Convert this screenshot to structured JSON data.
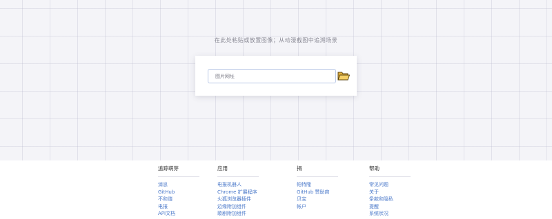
{
  "drop": {
    "hint": "在此处粘贴或放置图像；从动漫截图中追溯场景",
    "url_placeholder": "图片网址"
  },
  "footer": {
    "columns": [
      {
        "title": "追踪萌芽",
        "links": [
          "消息",
          "GitHub",
          "不和谐",
          "电报",
          "API文档"
        ]
      },
      {
        "title": "应用",
        "links": [
          "电报机器人",
          "Chrome 扩展程序",
          "火狐浏览器插件",
          "边缘附加组件",
          "歌剧附加组件"
        ]
      },
      {
        "title": "捐",
        "links": [
          "帕特隆",
          "GitHub 赞助商",
          "贝宝",
          "帐户"
        ]
      },
      {
        "title": "帮助",
        "links": [
          "常见问题",
          "关于",
          "条款和隐私",
          "提醒",
          "系统状况"
        ]
      }
    ]
  }
}
